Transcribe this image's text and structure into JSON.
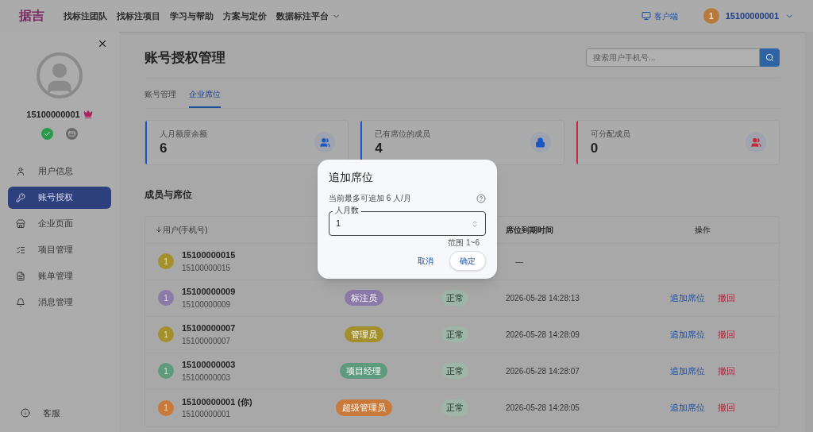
{
  "topbar": {
    "logo": "据吉",
    "nav": [
      {
        "label": "找标注团队",
        "dropdown": false
      },
      {
        "label": "找标注项目",
        "dropdown": false
      },
      {
        "label": "学习与帮助",
        "dropdown": false
      },
      {
        "label": "方案与定价",
        "dropdown": false
      },
      {
        "label": "数据标注平台",
        "dropdown": true
      }
    ],
    "client_link": "客户端",
    "user": {
      "avatar": "1",
      "name": "15100000001"
    }
  },
  "sidebar": {
    "username": "15100000001",
    "items": [
      {
        "label": "用户信息",
        "selected": false
      },
      {
        "label": "账号授权",
        "selected": true
      },
      {
        "label": "企业页面",
        "selected": false
      },
      {
        "label": "项目管理",
        "selected": false
      },
      {
        "label": "账单管理",
        "selected": false
      },
      {
        "label": "消息管理",
        "selected": false
      }
    ],
    "support": "客服"
  },
  "page": {
    "title": "账号授权管理",
    "search": {
      "placeholder": "搜索用户手机号..."
    },
    "tabs": [
      {
        "label": "账号管理",
        "selected": false
      },
      {
        "label": "企业席位",
        "selected": true
      }
    ],
    "stats": [
      {
        "label": "人月额度余额",
        "value": "6",
        "color": "#1a56c4"
      },
      {
        "label": "已有席位的成员",
        "value": "4",
        "color": "#1a56c4"
      },
      {
        "label": "可分配成员",
        "value": "0",
        "color": "#c0283b"
      }
    ],
    "section_title": "成员与席位",
    "table": {
      "columns": [
        "用户(手机号)",
        "席位到期时间",
        "操作"
      ],
      "rows": [
        {
          "avatar": "1",
          "color": "#a3902d",
          "name": "15100000015",
          "phone": "15100000015",
          "expiry": "—"
        },
        {
          "avatar": "1",
          "color": "#8b79a8",
          "name": "15100000009",
          "phone": "15100000009",
          "role": "标注员",
          "status": "正常",
          "expiry": "2026-05-28 14:28:13",
          "actions": [
            "追加席位",
            "撤回"
          ]
        },
        {
          "avatar": "1",
          "color": "#a3902d",
          "name": "15100000007",
          "phone": "15100000007",
          "role": "管理员",
          "status": "正常",
          "expiry": "2026-05-28 14:28:09",
          "actions": [
            "追加席位",
            "撤回"
          ]
        },
        {
          "avatar": "1",
          "color": "#5e9a7e",
          "name": "15100000003",
          "phone": "15100000003",
          "role": "项目经理",
          "status": "正常",
          "expiry": "2026-05-28 14:28:07",
          "actions": [
            "追加席位",
            "撤回"
          ]
        },
        {
          "avatar": "1",
          "color": "#c97a3a",
          "name": "15100000001 (你)",
          "phone": "15100000001",
          "role": "超级管理员",
          "status": "正常",
          "expiry": "2026-05-28 14:28:05",
          "actions": [
            "追加席位",
            "撤回"
          ]
        }
      ]
    }
  },
  "dialog": {
    "title": "追加席位",
    "hint": "当前最多可追加 6 人/月",
    "field": {
      "label": "人月数",
      "value": "1",
      "helper": "范围 1~6"
    },
    "buttons": [
      "取消",
      "确定"
    ]
  }
}
